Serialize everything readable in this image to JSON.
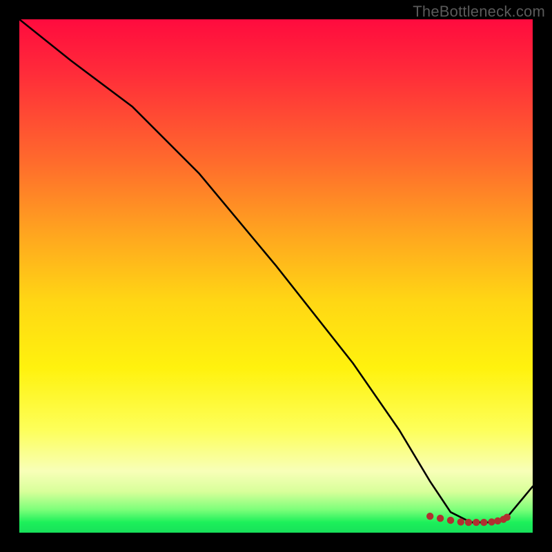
{
  "watermark": "TheBottleneck.com",
  "chart_data": {
    "type": "line",
    "title": "",
    "xlabel": "",
    "ylabel": "",
    "xlim": [
      0,
      100
    ],
    "ylim": [
      0,
      100
    ],
    "gradient_bands": [
      {
        "name": "red",
        "approx_y_range": [
          70,
          100
        ]
      },
      {
        "name": "orange",
        "approx_y_range": [
          45,
          70
        ]
      },
      {
        "name": "yellow",
        "approx_y_range": [
          15,
          45
        ]
      },
      {
        "name": "pale",
        "approx_y_range": [
          5,
          15
        ]
      },
      {
        "name": "green",
        "approx_y_range": [
          0,
          5
        ]
      }
    ],
    "series": [
      {
        "name": "bottleneck-curve",
        "x": [
          0,
          10,
          22,
          35,
          50,
          65,
          74,
          80,
          84,
          88,
          92,
          95,
          100
        ],
        "values": [
          100,
          92,
          83,
          70,
          52,
          33,
          20,
          10,
          4,
          2,
          2,
          3,
          9
        ]
      }
    ],
    "markers": {
      "name": "highlight-dots",
      "x": [
        80,
        82,
        84,
        86,
        87.5,
        89,
        90.5,
        92,
        93.2,
        94.3,
        95
      ],
      "values": [
        3.2,
        2.8,
        2.4,
        2.1,
        2.0,
        2.0,
        2.0,
        2.1,
        2.3,
        2.6,
        3.0
      ],
      "color": "#b03030"
    }
  }
}
